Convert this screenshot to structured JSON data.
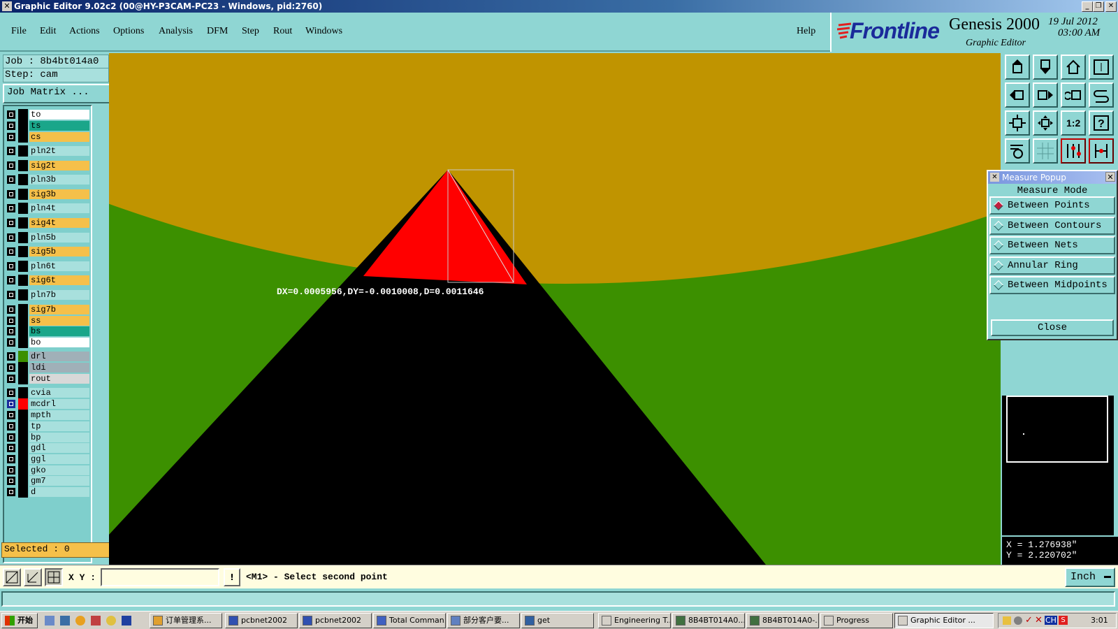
{
  "window": {
    "title": "Graphic Editor 9.02c2 (00@HY-P3CAM-PC23 - Windows, pid:2760)"
  },
  "menu": {
    "items": [
      "File",
      "Edit",
      "Actions",
      "Options",
      "Analysis",
      "DFM",
      "Step",
      "Rout",
      "Windows"
    ],
    "help": "Help"
  },
  "brand": {
    "logo": "Frontline",
    "product": "Genesis 2000",
    "subtitle": "Graphic Editor",
    "date": "19 Jul 2012",
    "time": "03:00 AM"
  },
  "job": {
    "job_label": "Job : 8b4bt014a0",
    "step_label": "Step: cam",
    "matrix_button": "Job Matrix ..."
  },
  "layers": [
    {
      "name": "to",
      "color": "#ffffff"
    },
    {
      "name": "ts",
      "color": "#1aa68a"
    },
    {
      "name": "cs",
      "color": "#f5c04a"
    },
    {
      "name": "pln2t",
      "color": "#a8e0dd"
    },
    {
      "name": "sig2t",
      "color": "#f5c04a"
    },
    {
      "name": "pln3b",
      "color": "#a8e0dd"
    },
    {
      "name": "sig3b",
      "color": "#f5c04a"
    },
    {
      "name": "pln4t",
      "color": "#a8e0dd"
    },
    {
      "name": "sig4t",
      "color": "#f5c04a"
    },
    {
      "name": "pln5b",
      "color": "#a8e0dd"
    },
    {
      "name": "sig5b",
      "color": "#f5c04a"
    },
    {
      "name": "pln6t",
      "color": "#a8e0dd"
    },
    {
      "name": "sig6t",
      "color": "#f5c04a"
    },
    {
      "name": "pln7b",
      "color": "#a8e0dd"
    },
    {
      "name": "sig7b",
      "color": "#f5c04a"
    },
    {
      "name": "ss",
      "color": "#f5c04a"
    },
    {
      "name": "bs",
      "color": "#1aa68a"
    },
    {
      "name": "bo",
      "color": "#ffffff"
    },
    {
      "name": "drl",
      "color": "#a0b0b8"
    },
    {
      "name": "ldi",
      "color": "#a0b0b8"
    },
    {
      "name": "rout",
      "color": "#d8d8d8"
    },
    {
      "name": "cvia",
      "color": "#a8e0dd"
    },
    {
      "name": "mcdrl",
      "color": "#a8e0dd"
    },
    {
      "name": "mpth",
      "color": "#a8e0dd"
    },
    {
      "name": "tp",
      "color": "#a8e0dd"
    },
    {
      "name": "bp",
      "color": "#a8e0dd"
    },
    {
      "name": "gdl",
      "color": "#a8e0dd"
    },
    {
      "name": "ggl",
      "color": "#a8e0dd"
    },
    {
      "name": "gko",
      "color": "#a8e0dd"
    },
    {
      "name": "gm7",
      "color": "#a8e0dd"
    },
    {
      "name": "d",
      "color": "#a8e0dd"
    }
  ],
  "selected_text": "Selected : 0",
  "measure_text": "DX=0.0005956,DY=-0.0010008,D=0.0011646",
  "measure_popup": {
    "title": "Measure Popup",
    "heading": "Measure Mode",
    "options": [
      "Between Points",
      "Between Contours",
      "Between Nets",
      "Annular Ring",
      "Between Midpoints"
    ],
    "selected": "Between Points",
    "close": "Close"
  },
  "coords": {
    "x": "X = 1.276938\"",
    "y": "Y = 2.220702\""
  },
  "command": {
    "xy_label": "X Y :",
    "xy_value": "",
    "prompt": "<M1> - Select second point",
    "units": "Inch"
  },
  "colors": {
    "canvas_copper": "#c09400",
    "canvas_green": "#3c9000",
    "highlight": "#ff0000",
    "active_layer_swatch": "#ff0000"
  },
  "taskbar": {
    "start": "开始",
    "tasks": [
      "订单管理系...",
      "pcbnet2002",
      "pcbnet2002",
      "Total Comman...",
      "部分客户要...",
      "get",
      "Engineering T...",
      "8B4BT014A0...",
      "8B4BT014A0-...",
      "Progress",
      "Graphic Editor ..."
    ],
    "active_task": "Graphic Editor ...",
    "clock": "3:01",
    "tray_ime": "CH"
  }
}
